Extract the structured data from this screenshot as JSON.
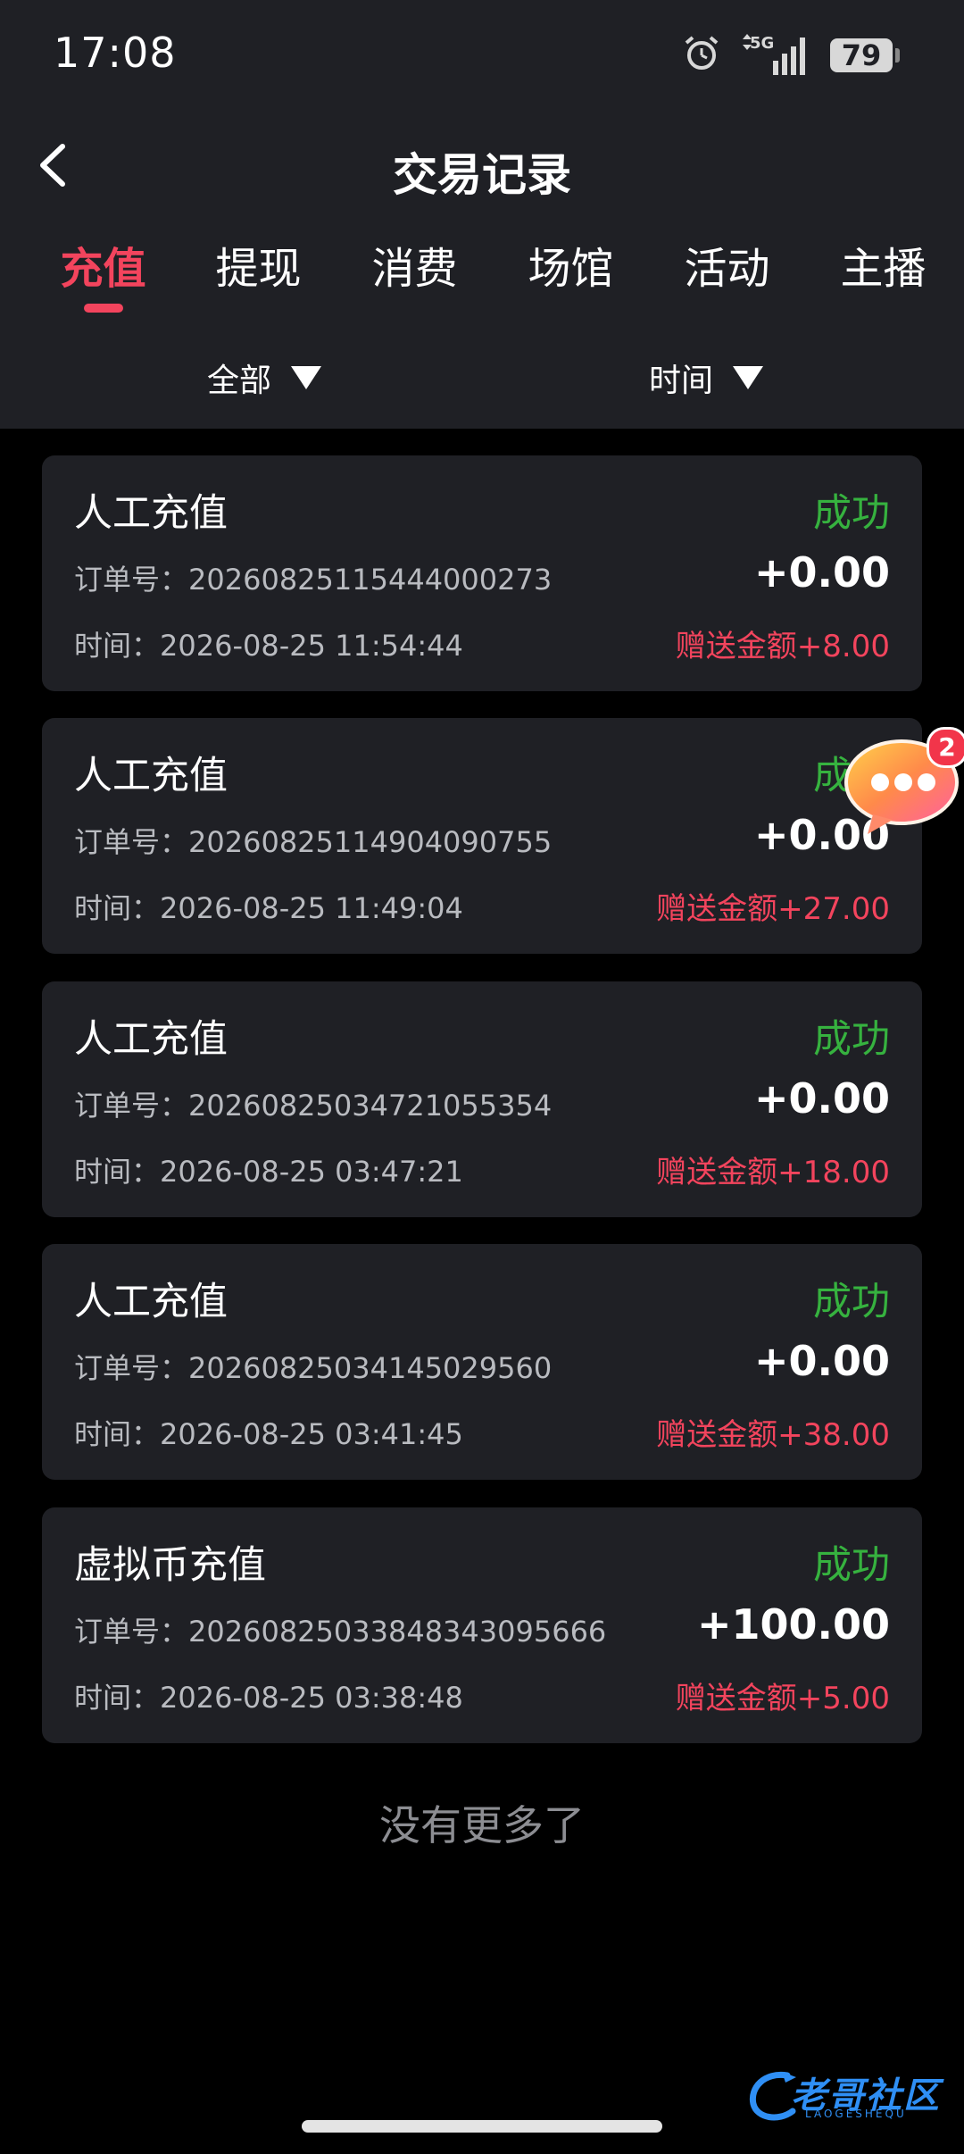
{
  "status_bar": {
    "time": "17:08",
    "network": "5G",
    "battery": "79"
  },
  "header": {
    "title": "交易记录"
  },
  "tabs": [
    {
      "label": "充值",
      "active": true
    },
    {
      "label": "提现",
      "active": false
    },
    {
      "label": "消费",
      "active": false
    },
    {
      "label": "场馆",
      "active": false
    },
    {
      "label": "活动",
      "active": false
    },
    {
      "label": "主播",
      "active": false
    }
  ],
  "filters": {
    "type": "全部",
    "time": "时间"
  },
  "records": [
    {
      "type": "人工充值",
      "status": "成功",
      "order_label": "订单号：",
      "order_no": "20260825115444000273",
      "amount": "+0.00",
      "time_label": "时间：",
      "time": "2026-08-25 11:54:44",
      "bonus": "赠送金额+8.00"
    },
    {
      "type": "人工充值",
      "status": "成功",
      "order_label": "订单号：",
      "order_no": "20260825114904090755",
      "amount": "+0.00",
      "time_label": "时间：",
      "time": "2026-08-25 11:49:04",
      "bonus": "赠送金额+27.00"
    },
    {
      "type": "人工充值",
      "status": "成功",
      "order_label": "订单号：",
      "order_no": "20260825034721055354",
      "amount": "+0.00",
      "time_label": "时间：",
      "time": "2026-08-25 03:47:21",
      "bonus": "赠送金额+18.00"
    },
    {
      "type": "人工充值",
      "status": "成功",
      "order_label": "订单号：",
      "order_no": "20260825034145029560",
      "amount": "+0.00",
      "time_label": "时间：",
      "time": "2026-08-25 03:41:45",
      "bonus": "赠送金额+38.00"
    },
    {
      "type": "虚拟币充值",
      "status": "成功",
      "order_label": "订单号：",
      "order_no": "2026082503384834309566​6",
      "amount": "+100.00",
      "time_label": "时间：",
      "time": "2026-08-25 03:38:48",
      "bonus": "赠送金额+5.00"
    }
  ],
  "end_text": "没有更多了",
  "float_chat": {
    "badge": "2"
  },
  "watermark": {
    "text": "老哥社区",
    "sub": "LAOGESHEQU"
  },
  "colors": {
    "accent": "#f3445d",
    "success": "#36b23f",
    "card_bg": "#1f2025",
    "page_bg": "#000000"
  }
}
